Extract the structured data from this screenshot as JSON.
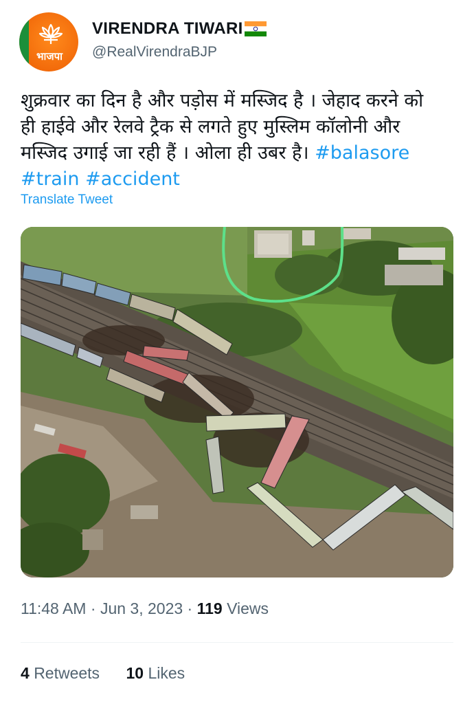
{
  "header": {
    "avatar_text": "भाजपा",
    "display_name": "VIRENDRA TIWARI",
    "handle": "@RealVirendraBJP"
  },
  "tweet": {
    "text_lines": [
      "शुक्रवार का दिन है और पड़ोस में मस्जिद है । जेहाद करने को",
      "ही हाईवे और रेलवे ट्रैक से लगते हुए मुस्लिम कॉलोनी और",
      "मस्जिद उगाई जा रही हैं । ओला ही उबर है।"
    ],
    "hashtags": [
      "#balasore",
      "#train",
      "#accident"
    ],
    "translate_label": "Translate Tweet"
  },
  "meta": {
    "time": "11:48 AM",
    "separator": "·",
    "date": "Jun 3, 2023",
    "views_count": "119",
    "views_label": "Views"
  },
  "stats": {
    "retweets_count": "4",
    "retweets_label": "Retweets",
    "likes_count": "10",
    "likes_label": "Likes"
  },
  "colors": {
    "accent": "#1d9bf0",
    "text": "#0f1419",
    "secondary": "#536471",
    "avatar_orange": "#f26a0a",
    "avatar_green": "#1b8f3a",
    "highlight_circle": "#5de08a"
  },
  "icons": [
    "lotus-icon",
    "india-flag-icon"
  ]
}
